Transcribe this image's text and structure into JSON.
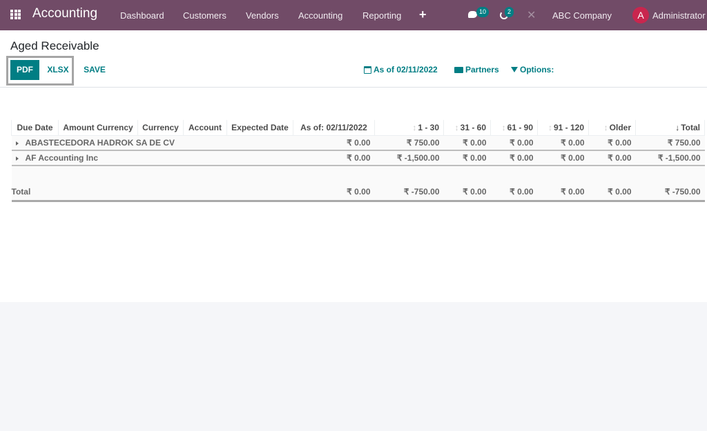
{
  "navbar": {
    "app_name": "Accounting",
    "menu": [
      "Dashboard",
      "Customers",
      "Vendors",
      "Accounting",
      "Reporting"
    ],
    "messages_count": "10",
    "activities_count": "2",
    "company": "ABC Company",
    "user_initial": "A",
    "user_name": "Administrator"
  },
  "control_panel": {
    "title": "Aged Receivable",
    "buttons": {
      "pdf": "PDF",
      "xlsx": "XLSX",
      "save": "SAVE"
    },
    "filters": {
      "date": "As of 02/11/2022",
      "partners": "Partners",
      "options": "Options:"
    }
  },
  "report": {
    "columns": [
      "Due Date",
      "Amount Currency",
      "Currency",
      "Account",
      "Expected Date",
      "As of: 02/11/2022",
      "1 - 30",
      "31 - 60",
      "61 - 90",
      "91 - 120",
      "Older",
      "Total"
    ],
    "rows": [
      {
        "partner": "ABASTECEDORA HADROK SA DE CV",
        "values": [
          "₹ 0.00",
          "₹ 750.00",
          "₹ 0.00",
          "₹ 0.00",
          "₹ 0.00",
          "₹ 0.00",
          "₹ 750.00"
        ]
      },
      {
        "partner": "AF Accounting Inc",
        "values": [
          "₹ 0.00",
          "₹ -1,500.00",
          "₹ 0.00",
          "₹ 0.00",
          "₹ 0.00",
          "₹ 0.00",
          "₹ -1,500.00"
        ]
      }
    ],
    "total": {
      "label": "Total",
      "values": [
        "₹ 0.00",
        "₹ -750.00",
        "₹ 0.00",
        "₹ 0.00",
        "₹ 0.00",
        "₹ 0.00",
        "₹ -750.00"
      ]
    }
  },
  "colors": {
    "navbar": "#714b67",
    "accent": "#017e84",
    "avatar": "#c9264e"
  }
}
